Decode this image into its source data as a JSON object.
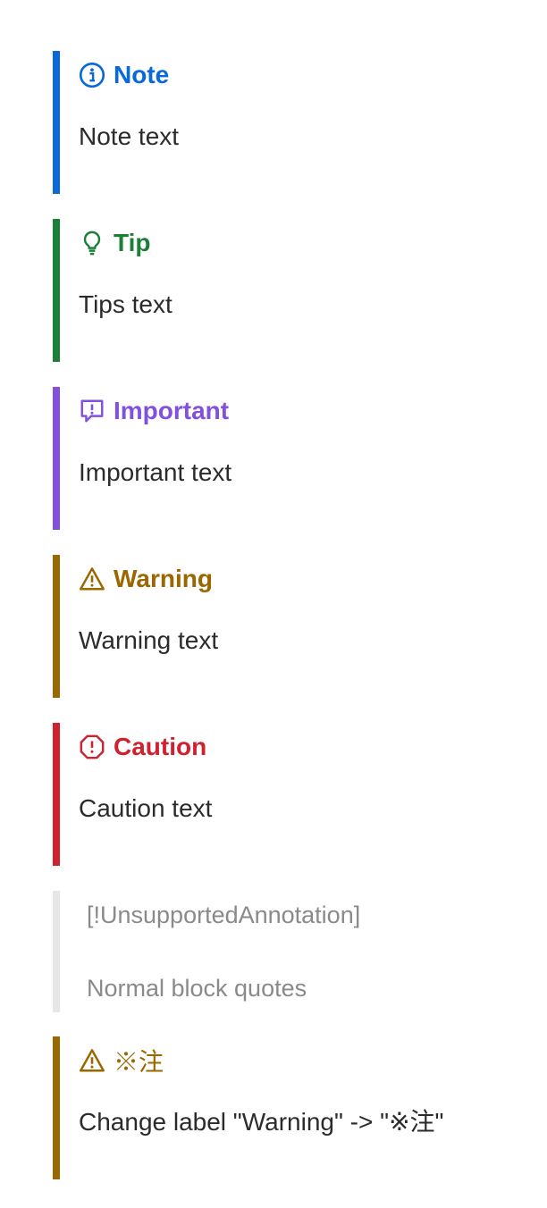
{
  "alerts": [
    {
      "title": "Note",
      "text": "Note text",
      "icon": "info-icon",
      "color": "#0969da"
    },
    {
      "title": "Tip",
      "text": "Tips text",
      "icon": "lightbulb-icon",
      "color": "#1a7f37"
    },
    {
      "title": "Important",
      "text": "Important text",
      "icon": "speech-bubble-exclamation-icon",
      "color": "#8250df"
    },
    {
      "title": "Warning",
      "text": "Warning text",
      "icon": "warning-triangle-icon",
      "color": "#9a6700"
    },
    {
      "title": "Caution",
      "text": "Caution text",
      "icon": "octagon-exclamation-icon",
      "color": "#cf222e"
    }
  ],
  "plain_quote": {
    "line1": "[!UnsupportedAnnotation]",
    "line2": "Normal block quotes"
  },
  "custom_alert": {
    "title": "※注",
    "text": "Change label \"Warning\" -> \"※注\"",
    "icon": "warning-triangle-icon",
    "color": "#9a6700"
  }
}
